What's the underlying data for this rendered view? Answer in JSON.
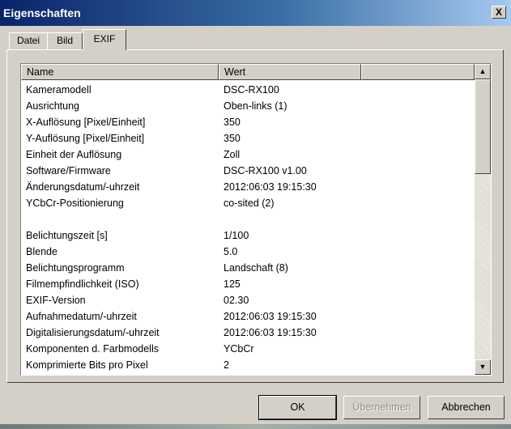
{
  "window": {
    "title": "Eigenschaften",
    "close_glyph": "X"
  },
  "tabs": [
    {
      "label": "Datei",
      "active": false
    },
    {
      "label": "Bild",
      "active": false
    },
    {
      "label": "EXIF",
      "active": true
    }
  ],
  "list": {
    "columns": [
      "Name",
      "Wert"
    ],
    "rows": [
      {
        "name": "Kameramodell",
        "value": "DSC-RX100"
      },
      {
        "name": "Ausrichtung",
        "value": "Oben-links (1)"
      },
      {
        "name": "X-Auflösung [Pixel/Einheit]",
        "value": "350"
      },
      {
        "name": "Y-Auflösung [Pixel/Einheit]",
        "value": "350"
      },
      {
        "name": "Einheit der Auflösung",
        "value": "Zoll"
      },
      {
        "name": "Software/Firmware",
        "value": "DSC-RX100 v1.00"
      },
      {
        "name": "Änderungsdatum/-uhrzeit",
        "value": "2012:06:03 19:15:30"
      },
      {
        "name": "YCbCr-Positionierung",
        "value": "co-sited (2)"
      },
      {
        "name": "",
        "value": ""
      },
      {
        "name": "Belichtungszeit [s]",
        "value": "1/100"
      },
      {
        "name": "Blende",
        "value": "5.0"
      },
      {
        "name": "Belichtungsprogramm",
        "value": "Landschaft (8)"
      },
      {
        "name": "Filmempfindlichkeit (ISO)",
        "value": "125"
      },
      {
        "name": "EXIF-Version",
        "value": "02.30"
      },
      {
        "name": "Aufnahmedatum/-uhrzeit",
        "value": "2012:06:03 19:15:30"
      },
      {
        "name": "Digitalisierungsdatum/-uhrzeit",
        "value": "2012:06:03 19:15:30"
      },
      {
        "name": "Komponenten d. Farbmodells",
        "value": "YCbCr"
      },
      {
        "name": "Komprimierte Bits pro Pixel",
        "value": "2"
      }
    ]
  },
  "scrollbar": {
    "up_icon": "scroll-up-arrow",
    "down_icon": "scroll-down-arrow"
  },
  "buttons": {
    "ok": "OK",
    "apply": "Übernehmen",
    "cancel": "Abbrechen"
  }
}
